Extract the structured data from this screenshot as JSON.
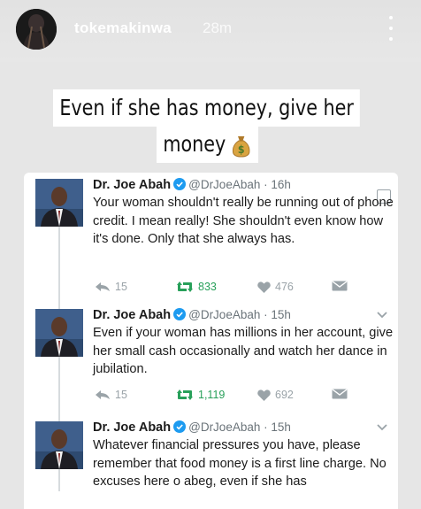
{
  "story": {
    "username": "tokemakinwa",
    "time_ago": "28m"
  },
  "caption": {
    "line1": "Even if she has money, give her",
    "line2": "money"
  },
  "colors": {
    "retweet_green": "#28a05a",
    "muted": "#9aa3a8",
    "verified_blue": "#1d9bf0"
  },
  "tweets": [
    {
      "name": "Dr. Joe Abah",
      "handle": "@DrJoeAbah · 16h",
      "text": "Your woman shouldn't really be running out of phone credit. I mean really! She shouldn't even know how it's done. Only that she always has.",
      "replies": "15",
      "retweets": "833",
      "likes": "476"
    },
    {
      "name": "Dr. Joe Abah",
      "handle": "@DrJoeAbah · 15h",
      "text": "Even if your woman has millions in her account, give her small cash occasionally and watch her dance in jubilation.",
      "replies": "15",
      "retweets": "1,119",
      "likes": "692"
    },
    {
      "name": "Dr. Joe Abah",
      "handle": "@DrJoeAbah · 15h",
      "text": "Whatever financial pressures you have, please remember that food money is a first line charge. No excuses here o abeg, even if she has"
    }
  ],
  "icons": {
    "more": "vertical-dots-icon",
    "money": "money-bag-icon",
    "reply": "reply-arrow-icon",
    "retweet": "retweet-icon",
    "like": "heart-icon",
    "dm": "envelope-icon",
    "verified": "verified-badge-icon",
    "chevron": "chevron-down-icon"
  }
}
